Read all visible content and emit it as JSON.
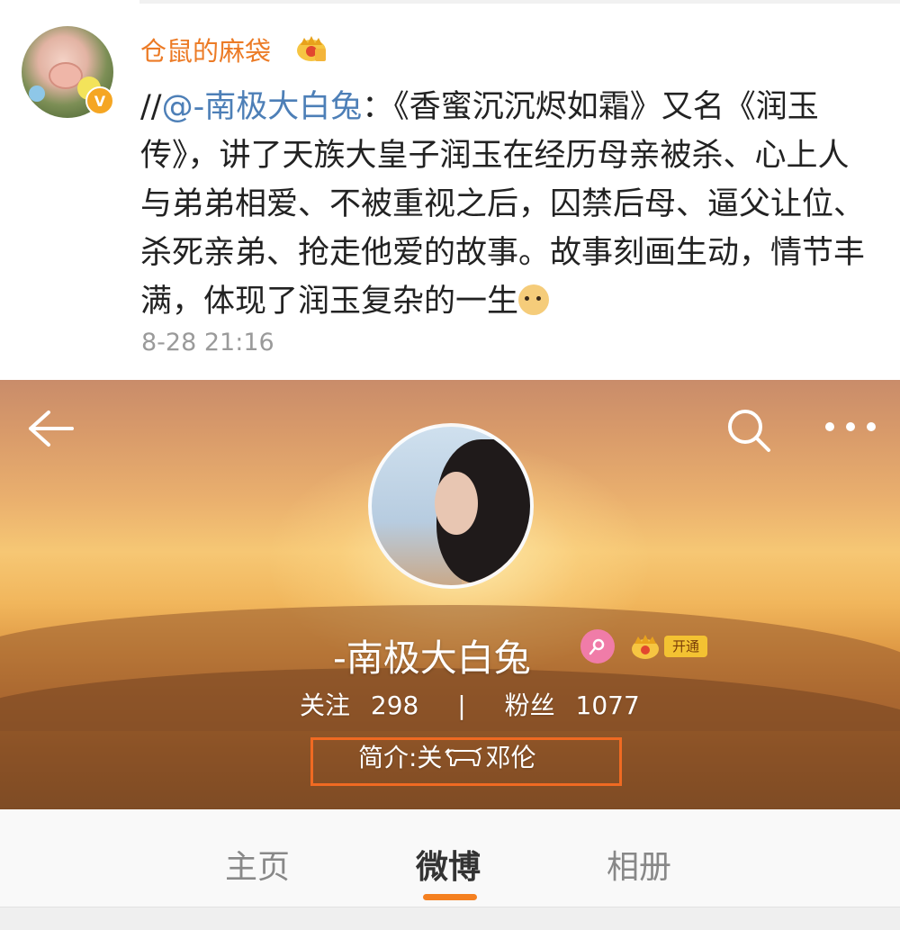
{
  "post": {
    "username": "仓鼠的麻袋",
    "avatar_caption": "委屈",
    "text_prefix": "//",
    "mention": "@-南极大白兔",
    "text_body": "：《香蜜沉沉烬如霜》又名《润玉传》，讲了天族大皇子润玉在经历母亲被杀、心上人与弟弟相爱、不被重视之后，囚禁后母、逼父让位、杀死亲弟、抢走他爱的故事。故事刻画生动，情节丰满，体现了润玉复杂的一生",
    "timestamp": "8-28 21:16"
  },
  "profile": {
    "name": "-南极大白兔",
    "vip_label": "开通",
    "following_label": "关注",
    "following_count": "298",
    "separator": "|",
    "followers_label": "粉丝",
    "followers_count": "1077",
    "bio_prefix": "简介:关",
    "bio_suffix": "邓伦"
  },
  "tabs": {
    "home": "主页",
    "weibo": "微博",
    "album": "相册",
    "active": "weibo"
  },
  "colors": {
    "username": "#ec7b26",
    "mention": "#4d7fb7",
    "tab_indicator": "#f58020",
    "highlight_box": "#f06a22"
  },
  "icons": [
    "back-arrow-icon",
    "search-icon",
    "more-icon",
    "female-icon",
    "crown-icon",
    "verified-icon",
    "doge-emoji-icon",
    "cow-emoji-icon"
  ]
}
